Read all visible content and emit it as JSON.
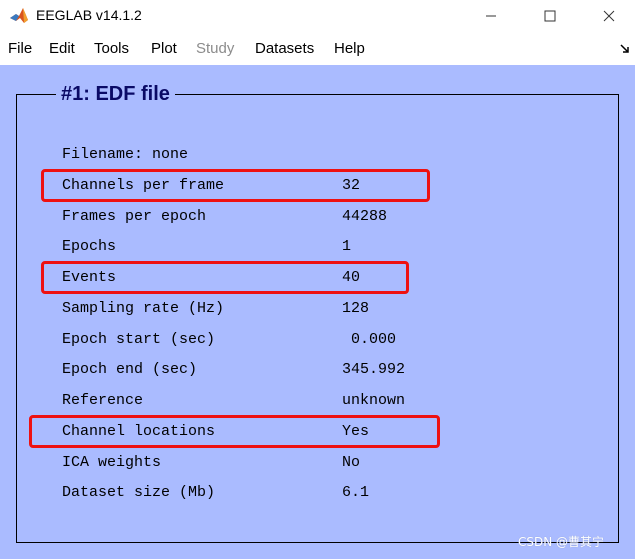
{
  "window": {
    "title": "EEGLAB v14.1.2"
  },
  "menu": {
    "items": [
      {
        "label": "File",
        "enabled": true
      },
      {
        "label": "Edit",
        "enabled": true
      },
      {
        "label": "Tools",
        "enabled": true
      },
      {
        "label": "Plot",
        "enabled": true
      },
      {
        "label": "Study",
        "enabled": false
      },
      {
        "label": "Datasets",
        "enabled": true
      },
      {
        "label": "Help",
        "enabled": true
      }
    ]
  },
  "panel": {
    "title": "#1: EDF file",
    "rows": [
      {
        "label": "Filename: none",
        "value": ""
      },
      {
        "label": "Channels per frame",
        "value": "32",
        "highlighted": true
      },
      {
        "label": "Frames per epoch",
        "value": "44288"
      },
      {
        "label": "Epochs",
        "value": "1"
      },
      {
        "label": "Events",
        "value": "40",
        "highlighted": true
      },
      {
        "label": "Sampling rate (Hz)",
        "value": "128"
      },
      {
        "label": "Epoch start (sec)",
        "value": " 0.000"
      },
      {
        "label": "Epoch end (sec)",
        "value": "345.992"
      },
      {
        "label": "Reference",
        "value": "unknown"
      },
      {
        "label": "Channel locations",
        "value": "Yes",
        "highlighted": true
      },
      {
        "label": "ICA weights",
        "value": "No"
      },
      {
        "label": "Dataset size (Mb)",
        "value": "6.1"
      }
    ]
  },
  "watermark": {
    "text": "CSDN @曹其宁"
  },
  "colors": {
    "background": "#aabbff",
    "title": "#0a0a66",
    "highlight": "#ee1111",
    "disabled": "#8c8c8c"
  }
}
